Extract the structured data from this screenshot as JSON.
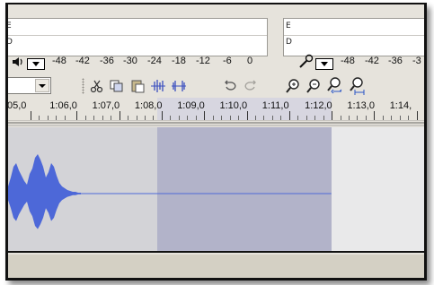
{
  "meters": {
    "playback_box_letters": [
      "E",
      "D"
    ],
    "record_box_letters": [
      "E",
      "D"
    ],
    "playback_scale": [
      "-48",
      "-42",
      "-36",
      "-30",
      "-24",
      "-18",
      "-12",
      "-6",
      "0"
    ],
    "record_scale": [
      "-48",
      "-42",
      "-36",
      "-3"
    ],
    "speaker_icon": "speaker-icon",
    "mic_icon": "microphone-icon"
  },
  "toolbar": {
    "tools": [
      "cut-icon",
      "copy-icon",
      "paste-icon",
      "trim-icon",
      "silence-icon",
      "undo-icon",
      "redo-icon",
      "zoom-in-icon",
      "zoom-out-icon",
      "fit-selection-icon",
      "fit-project-icon"
    ]
  },
  "timeline": {
    "labels": [
      "05,0",
      "1:06,0",
      "1:07,0",
      "1:08,0",
      "1:09,0",
      "1:10,0",
      "1:11,0",
      "1:12,0",
      "1:13,0",
      "1:14,"
    ],
    "selection_start_fraction": 0.353,
    "selection_end_fraction": 0.767
  },
  "colors": {
    "waveform": "#4d68d8",
    "selection": "#b2b3c9",
    "background": "#e6e3dc"
  }
}
